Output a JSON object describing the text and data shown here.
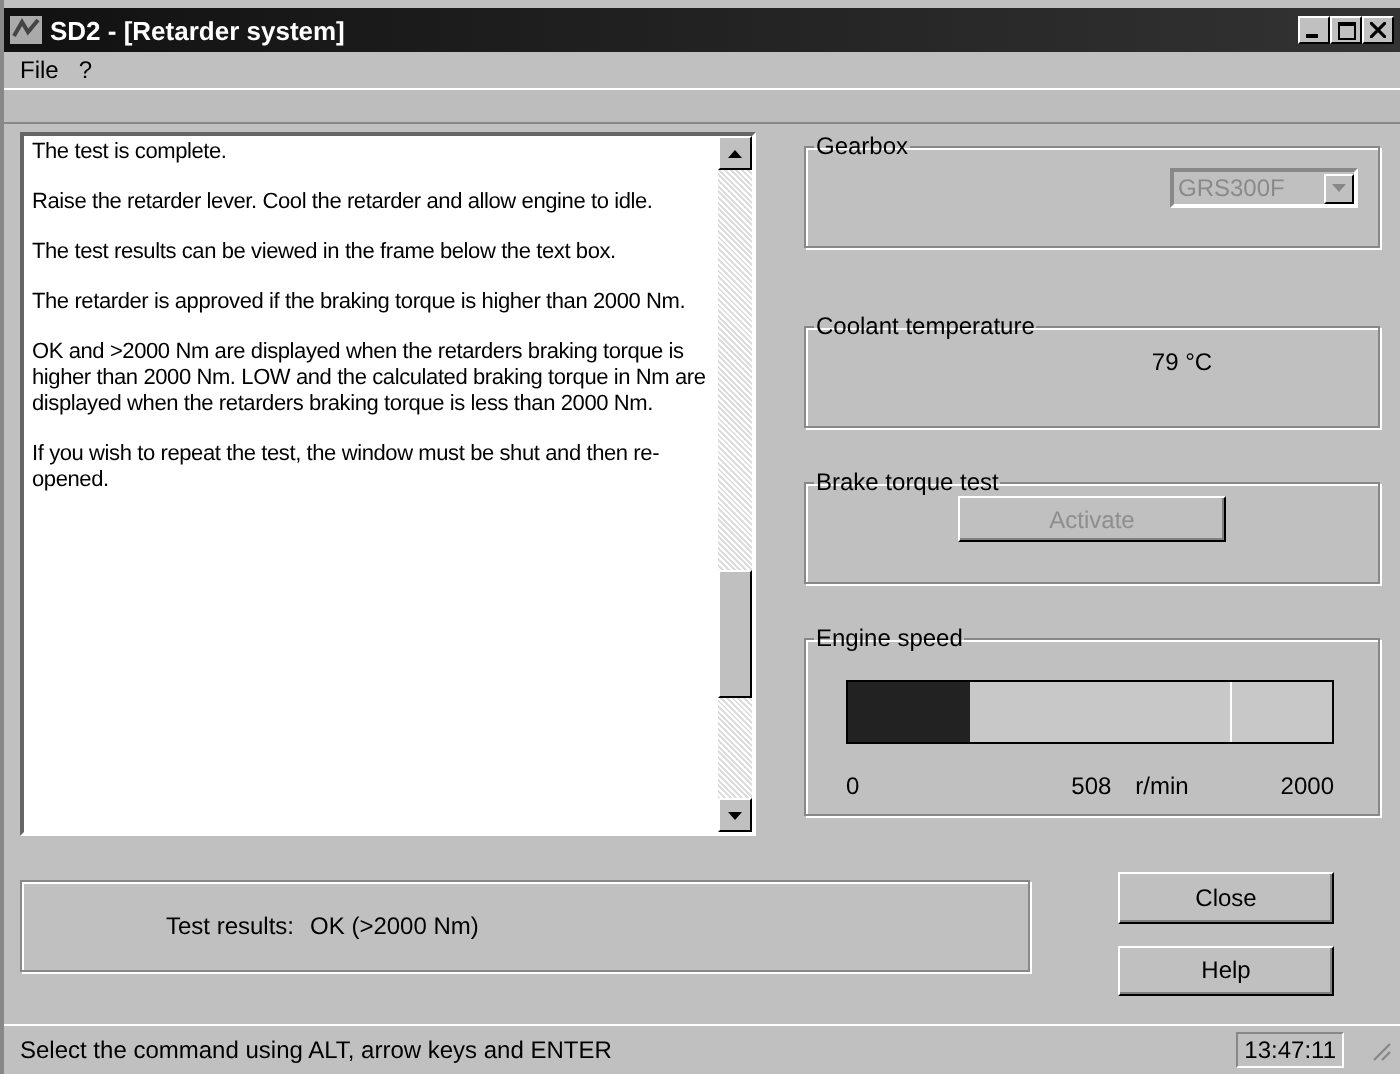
{
  "window": {
    "title": "SD2 - [Retarder system]"
  },
  "menu": [
    "File",
    "?"
  ],
  "instructions": [
    "The test is complete.",
    "Raise the retarder lever. Cool the retarder and allow engine to idle.",
    "The test results can be viewed in the frame below the text box.",
    "The retarder is approved if the braking torque is higher than 2000 Nm.",
    "OK and >2000 Nm are displayed when the retarders braking torque is higher than 2000 Nm. LOW and the calculated braking torque in Nm are displayed when the retarders braking torque is less than 2000 Nm.",
    "If you wish to repeat the test, the window must be shut and then re-opened."
  ],
  "gearbox": {
    "title": "Gearbox",
    "value": "GRS300F",
    "disabled": true
  },
  "coolant": {
    "title": "Coolant temperature",
    "value": "79 °C"
  },
  "brake_test": {
    "title": "Brake torque test",
    "button": "Activate",
    "disabled": true
  },
  "engine_speed": {
    "title": "Engine speed",
    "level": 0.254,
    "min": "0",
    "reading": "508",
    "unit": "r/min",
    "max": "2000"
  },
  "result": {
    "label": "Test results:",
    "value": "OK (>2000 Nm)"
  },
  "buttons": [
    "Close",
    "Help"
  ],
  "status_bar": {
    "text": "Select the command using ALT, arrow keys and ENTER",
    "time": "13:47:11"
  }
}
